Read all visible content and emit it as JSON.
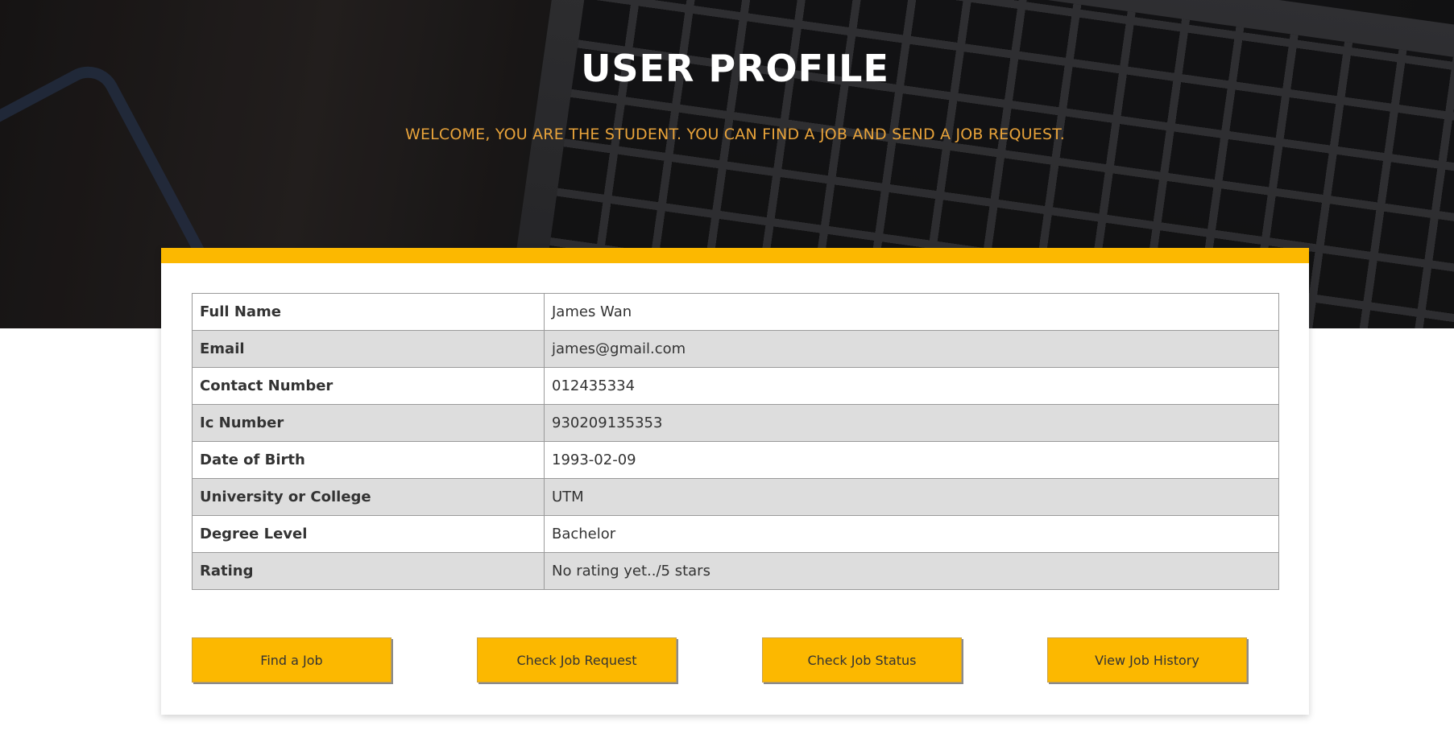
{
  "header": {
    "title": "USER PROFILE",
    "subtitle": "WELCOME, YOU ARE THE STUDENT. YOU CAN FIND A JOB AND SEND A JOB REQUEST."
  },
  "profile": {
    "rows": [
      {
        "label": "Full Name",
        "value": "James Wan"
      },
      {
        "label": "Email",
        "value": "james@gmail.com"
      },
      {
        "label": "Contact Number",
        "value": "012435334"
      },
      {
        "label": "Ic Number",
        "value": "930209135353"
      },
      {
        "label": "Date of Birth",
        "value": "1993-02-09"
      },
      {
        "label": "University or College",
        "value": "UTM"
      },
      {
        "label": "Degree Level",
        "value": "Bachelor"
      },
      {
        "label": "Rating",
        "value": "No rating yet../5 stars"
      }
    ]
  },
  "actions": {
    "find_job": "Find a Job",
    "check_request": "Check Job Request",
    "check_status": "Check Job Status",
    "view_history": "View Job History"
  },
  "colors": {
    "accent": "#fcb800",
    "subtitle": "#e8a33a",
    "row_alt": "#dddddd",
    "text": "#333333"
  }
}
